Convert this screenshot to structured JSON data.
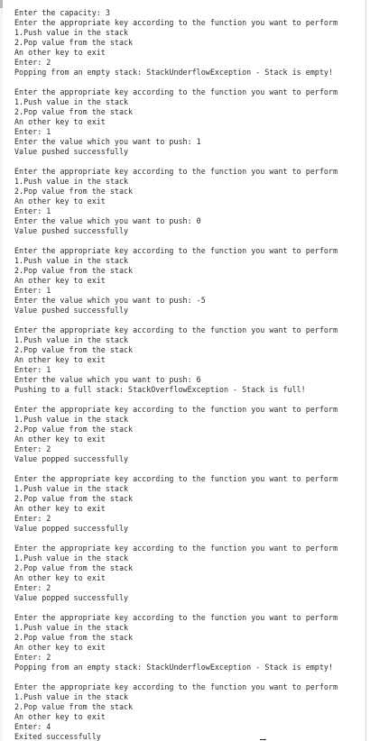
{
  "console": {
    "lines": [
      "Enter the capacity: 3",
      "Enter the appropriate key according to the function you want to perform",
      "1.Push value in the stack",
      "2.Pop value from the stack",
      "An other key to exit",
      "Enter: 2",
      "Popping from an empty stack: StackUnderflowException - Stack is empty!",
      "",
      "Enter the appropriate key according to the function you want to perform",
      "1.Push value in the stack",
      "2.Pop value from the stack",
      "An other key to exit",
      "Enter: 1",
      "Enter the value which you want to push: 1",
      "Value pushed successfully",
      "",
      "Enter the appropriate key according to the function you want to perform",
      "1.Push value in the stack",
      "2.Pop value from the stack",
      "An other key to exit",
      "Enter: 1",
      "Enter the value which you want to push: 0",
      "Value pushed successfully",
      "",
      "Enter the appropriate key according to the function you want to perform",
      "1.Push value in the stack",
      "2.Pop value from the stack",
      "An other key to exit",
      "Enter: 1",
      "Enter the value which you want to push: -5",
      "Value pushed successfully",
      "",
      "Enter the appropriate key according to the function you want to perform",
      "1.Push value in the stack",
      "2.Pop value from the stack",
      "An other key to exit",
      "Enter: 1",
      "Enter the value which you want to push: 6",
      "Pushing to a full stack: StackOverflowException - Stack is full!",
      "",
      "Enter the appropriate key according to the function you want to perform",
      "1.Push value in the stack",
      "2.Pop value from the stack",
      "An other key to exit",
      "Enter: 2",
      "Value popped successfully",
      "",
      "Enter the appropriate key according to the function you want to perform",
      "1.Push value in the stack",
      "2.Pop value from the stack",
      "An other key to exit",
      "Enter: 2",
      "Value popped successfully",
      "",
      "Enter the appropriate key according to the function you want to perform",
      "1.Push value in the stack",
      "2.Pop value from the stack",
      "An other key to exit",
      "Enter: 2",
      "Value popped successfully",
      "",
      "Enter the appropriate key according to the function you want to perform",
      "1.Push value in the stack",
      "2.Pop value from the stack",
      "An other key to exit",
      "Enter: 2",
      "Popping from an empty stack: StackUnderflowException - Stack is empty!",
      "",
      "Enter the appropriate key according to the function you want to perform",
      "1.Push value in the stack",
      "2.Pop value from the stack",
      "An other key to exit",
      "Enter: 4",
      "Exited successfully"
    ]
  }
}
